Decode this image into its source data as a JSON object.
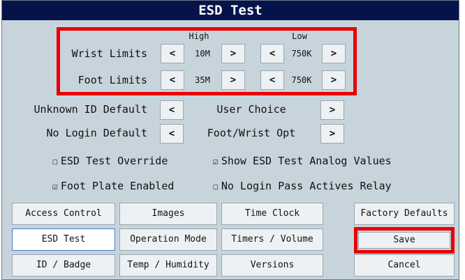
{
  "window": {
    "title": "ESD Test"
  },
  "limits": {
    "high_header": "High",
    "low_header": "Low",
    "rows": [
      {
        "label": "Wrist Limits",
        "high": "10M",
        "low": "750K"
      },
      {
        "label": "Foot Limits",
        "high": "35M",
        "low": "750K"
      }
    ],
    "dec": "<",
    "inc": ">"
  },
  "defaults": {
    "rows": [
      {
        "label": "Unknown ID Default",
        "value": "User Choice"
      },
      {
        "label": "No Login Default",
        "value": "Foot/Wrist Opt"
      }
    ]
  },
  "checks": {
    "unchecked_glyph": "☐",
    "checked_glyph": "☑",
    "items": [
      {
        "label": "ESD Test Override",
        "checked": false
      },
      {
        "label": "Show ESD Test Analog Values",
        "checked": true
      },
      {
        "label": "Foot Plate Enabled",
        "checked": true
      },
      {
        "label": "No Login Pass Actives Relay",
        "checked": false
      }
    ]
  },
  "nav": {
    "col1": [
      "Access Control",
      "ESD Test",
      "ID / Badge"
    ],
    "col2": [
      "Images",
      "Operation Mode",
      "Temp / Humidity"
    ],
    "col3": [
      "Time Clock",
      "Timers / Volume",
      "Versions"
    ],
    "col4": [
      "Factory Defaults",
      "Save",
      "Cancel"
    ],
    "active": "ESD Test"
  },
  "colors": {
    "title_bg": "#06134a",
    "panel_bg": "#c8d4dc",
    "highlight": "#e80000"
  }
}
